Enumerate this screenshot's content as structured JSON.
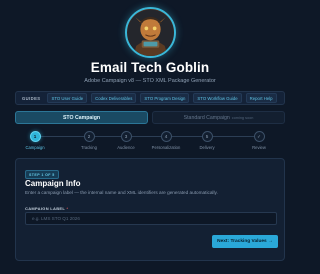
{
  "header": {
    "avatar_alt": "goblin-avatar",
    "title": "Email Tech Goblin",
    "subtitle": "Adobe Campaign v8 — STO XML Package Generator"
  },
  "guides": {
    "label": "GUIDES",
    "links": [
      "STO User Guide",
      "Codex Deliverables",
      "STO Program Design",
      "STO Workflow Guide",
      "Report Help"
    ]
  },
  "mode_tabs": [
    {
      "label": "STO Campaign",
      "active": true,
      "note": ""
    },
    {
      "label": "Standard Campaign",
      "active": false,
      "note": "coming soon"
    }
  ],
  "stepper": {
    "steps": [
      {
        "number": "1",
        "label": "Campaign",
        "active": true
      },
      {
        "number": "2",
        "label": "Tracking",
        "active": false
      },
      {
        "number": "3",
        "label": "Audience",
        "active": false
      },
      {
        "number": "4",
        "label": "Personalization",
        "active": false
      },
      {
        "number": "5",
        "label": "Delivery",
        "active": false
      },
      {
        "number": "✓",
        "label": "Review",
        "active": false
      }
    ]
  },
  "form": {
    "badge": "STEP 1 OF 5",
    "title": "Campaign Info",
    "description": "Enter a campaign label — the internal name and XML identifiers are generated automatically.",
    "field_label": "CAMPAIGN LABEL",
    "required_mark": "*",
    "input_value": "",
    "input_placeholder": "e.g. LMS STO Q1 2026",
    "next_label": "Next: Tracking Values →"
  },
  "colors": {
    "background": "#0e1827",
    "accent": "#2aa8d8",
    "card": "#132033"
  }
}
